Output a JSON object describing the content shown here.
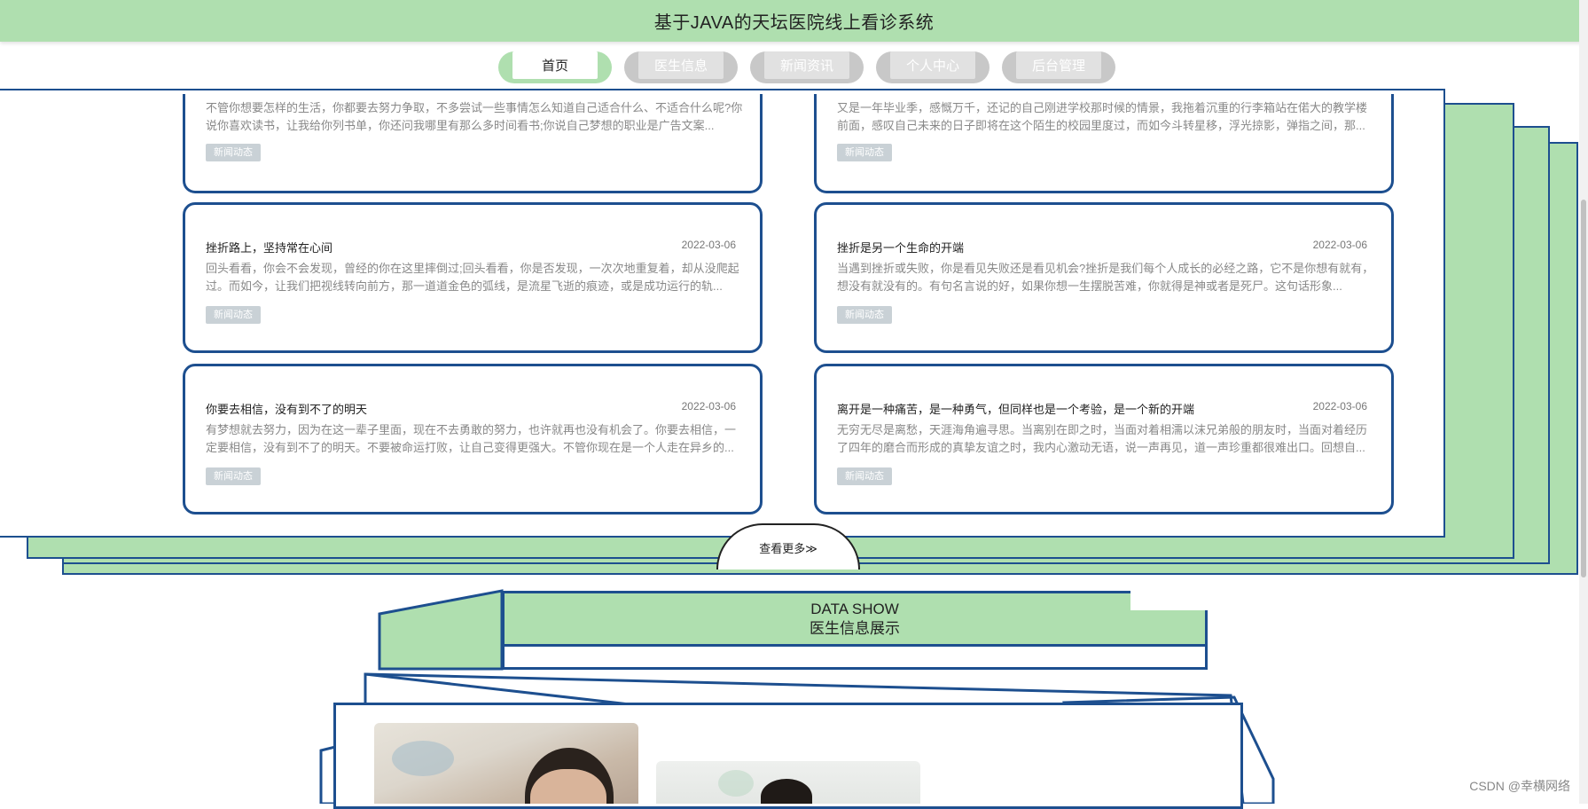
{
  "header": {
    "title": "基于JAVA的天坛医院线上看诊系统"
  },
  "nav": [
    {
      "label": "首页",
      "active": true
    },
    {
      "label": "医生信息",
      "active": false
    },
    {
      "label": "新闻资讯",
      "active": false
    },
    {
      "label": "个人中心",
      "active": false
    },
    {
      "label": "后台管理",
      "active": false
    }
  ],
  "news": {
    "top_cards": [
      {
        "text": "不管你想要怎样的生活，你都要去努力争取，不多尝试一些事情怎么知道自己适合什么、不适合什么呢?你说你喜欢读书，让我给你列书单，你还问我哪里有那么多时间看书;你说自己梦想的职业是广告文案...",
        "tag": "新闻动态"
      },
      {
        "text": "又是一年毕业季，感慨万千，还记的自己刚进学校那时候的情景，我拖着沉重的行李箱站在偌大的教学楼前面，感叹自己未来的日子即将在这个陌生的校园里度过，而如今斗转星移，浮光掠影，弹指之间，那...",
        "tag": "新闻动态"
      }
    ],
    "cards": [
      {
        "title": "挫折路上，坚持常在心间",
        "date": "2022-03-06",
        "text": "回头看看，你会不会发现，曾经的你在这里摔倒过;回头看看，你是否发现，一次次地重复着，却从没爬起过。而如今，让我们把视线转向前方，那一道道金色的弧线，是流星飞逝的痕迹，或是成功运行的轨...",
        "tag": "新闻动态"
      },
      {
        "title": "挫折是另一个生命的开端",
        "date": "2022-03-06",
        "text": "当遇到挫折或失败，你是看见失败还是看见机会?挫折是我们每个人成长的必经之路，它不是你想有就有，想没有就没有的。有句名言说的好，如果你想一生摆脱苦难，你就得是神或者是死尸。这句话形象...",
        "tag": "新闻动态"
      },
      {
        "title": "你要去相信，没有到不了的明天",
        "date": "2022-03-06",
        "text": "有梦想就去努力，因为在这一辈子里面，现在不去勇敢的努力，也许就再也没有机会了。你要去相信，一定要相信，没有到不了的明天。不要被命运打败，让自己变得更强大。不管你现在是一个人走在异乡的...",
        "tag": "新闻动态"
      },
      {
        "title": "离开是一种痛苦，是一种勇气，但同样也是一个考验，是一个新的开端",
        "date": "2022-03-06",
        "text": "无穷无尽是离愁，天涯海角遍寻思。当离别在即之时，当面对着相濡以沫兄弟般的朋友时，当面对着经历了四年的磨合而形成的真挚友谊之时，我内心激动无语，说一声再见，道一声珍重都很难出口。回想自...",
        "tag": "新闻动态"
      }
    ],
    "more_label": "查看更多≫"
  },
  "data_show": {
    "title_en": "DATA SHOW",
    "title_cn": "医生信息展示"
  },
  "watermark": "CSDN @幸横网络",
  "colors": {
    "green": "#afdfaf",
    "blue": "#1d4f8f",
    "gray": "#c8c8c8"
  }
}
